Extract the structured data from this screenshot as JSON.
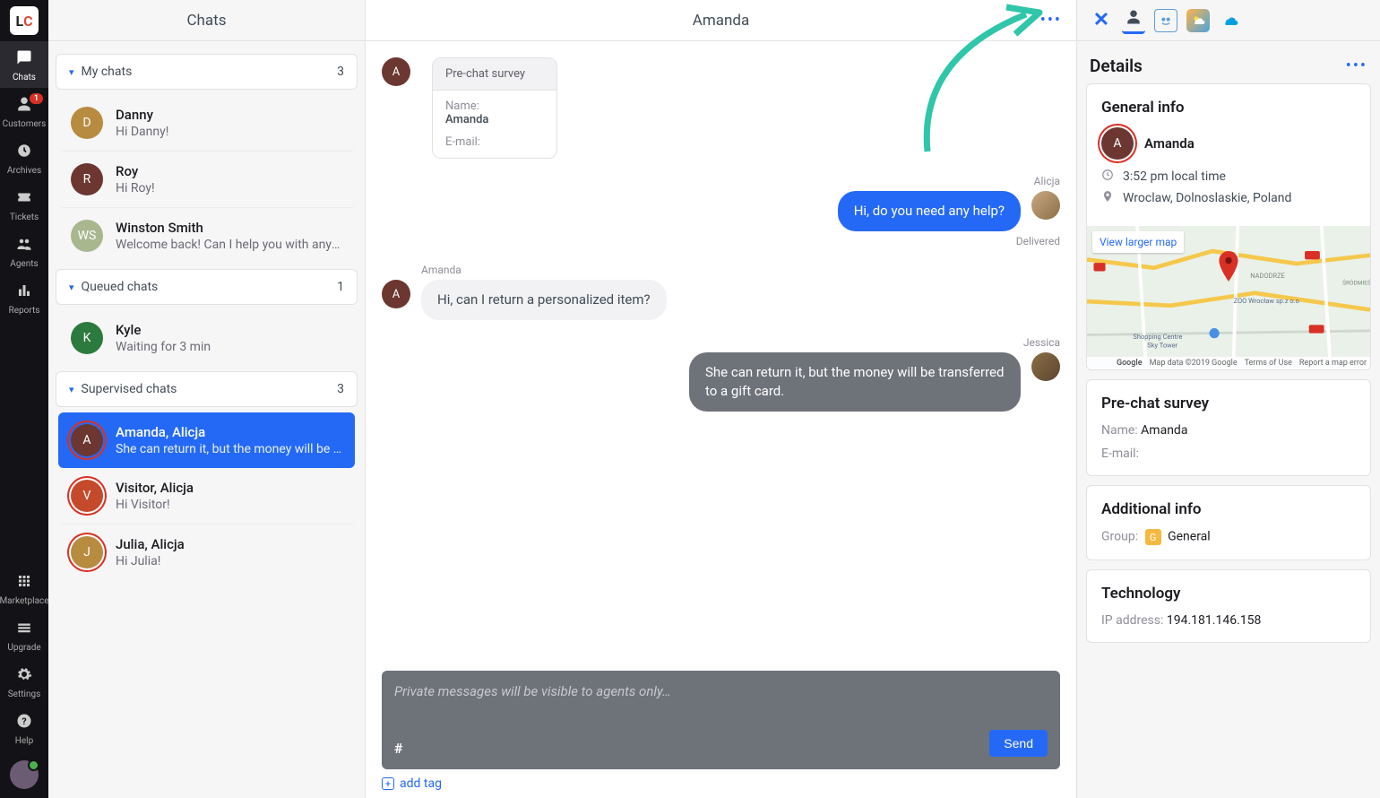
{
  "nav": {
    "items": [
      {
        "label": "Chats"
      },
      {
        "label": "Customers",
        "badge": "1"
      },
      {
        "label": "Archives"
      },
      {
        "label": "Tickets"
      },
      {
        "label": "Agents"
      },
      {
        "label": "Reports"
      }
    ],
    "bottom": [
      {
        "label": "Marketplace"
      },
      {
        "label": "Upgrade"
      },
      {
        "label": "Settings"
      },
      {
        "label": "Help"
      }
    ]
  },
  "chatsColumn": {
    "title": "Chats",
    "sections": {
      "my": {
        "label": "My chats",
        "count": "3"
      },
      "queued": {
        "label": "Queued chats",
        "count": "1"
      },
      "supervised": {
        "label": "Supervised chats",
        "count": "3"
      }
    },
    "myChats": [
      {
        "initials": "D",
        "color": "#b78b40",
        "name": "Danny",
        "snippet": "Hi Danny!"
      },
      {
        "initials": "R",
        "color": "#6b3730",
        "name": "Roy",
        "snippet": "Hi Roy!"
      },
      {
        "initials": "WS",
        "color": "#a8b78e",
        "name": "Winston Smith",
        "snippet": "Welcome back! Can I help you with anythi…"
      }
    ],
    "queuedChats": [
      {
        "initials": "K",
        "color": "#2d7a3e",
        "name": "Kyle",
        "snippet": "Waiting for 3 min"
      }
    ],
    "supervisedChats": [
      {
        "initials": "A",
        "color": "#6b3730",
        "name": "Amanda, Alicja",
        "snippet": "She can return it, but the money will be tr…",
        "selected": true
      },
      {
        "initials": "V",
        "color": "#c54a2c",
        "name": "Visitor, Alicja",
        "snippet": "Hi Visitor!"
      },
      {
        "initials": "J",
        "color": "#b78b40",
        "name": "Julia, Alicja",
        "snippet": "Hi Julia!"
      }
    ]
  },
  "conversation": {
    "title": "Amanda",
    "survey": {
      "header": "Pre-chat survey",
      "nameLabel": "Name:",
      "nameValue": "Amanda",
      "emailLabel": "E-mail:"
    },
    "messages": {
      "m1": {
        "author": "Alicja",
        "text": "Hi, do you need any help?",
        "status": "Delivered"
      },
      "m2": {
        "author": "Amanda",
        "text": "Hi, can I return a personalized item?"
      },
      "m3": {
        "author": "Jessica",
        "text": "She can return it, but the money will be transferred to a gift card."
      }
    },
    "composer": {
      "placeholder": "Private messages will be visible to agents only…",
      "hash": "#",
      "send": "Send",
      "addTag": "add tag"
    }
  },
  "details": {
    "title": "Details",
    "generalInfo": {
      "title": "General info",
      "name": "Amanda",
      "time": "3:52 pm local time",
      "location": "Wroclaw, Dolnoslaskie, Poland"
    },
    "map": {
      "viewLarger": "View larger map",
      "credits": "Map data ©2019 Google",
      "terms": "Terms of Use",
      "report": "Report a map error",
      "google": "Google"
    },
    "prechat": {
      "title": "Pre-chat survey",
      "nameLabel": "Name: ",
      "nameValue": "Amanda",
      "emailLabel": "E-mail:"
    },
    "additional": {
      "title": "Additional info",
      "groupLabel": "Group:",
      "groupBadge": "G",
      "groupValue": "General"
    },
    "technology": {
      "title": "Technology",
      "ipLabel": "IP address: ",
      "ipValue": "194.181.146.158"
    }
  }
}
